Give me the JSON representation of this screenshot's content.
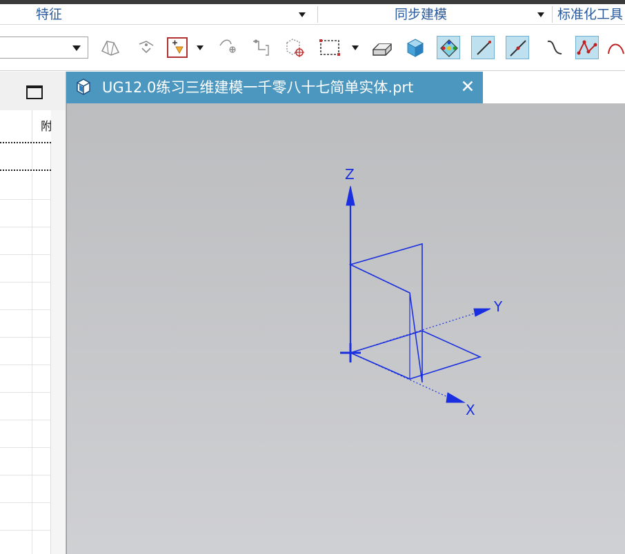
{
  "app": {
    "ribbon_groups": [
      {
        "label": "特征",
        "has_dropdown": true
      },
      {
        "label": "同步建模",
        "has_dropdown": true
      },
      {
        "label": "标准化工具",
        "has_dropdown": false
      }
    ]
  },
  "toolbar": {
    "selection_filter_value": "",
    "icons": [
      "surface-analysis-icon",
      "edge-blend-icon",
      "snap-point-icon",
      "point-constructor-icon",
      "curve-from-point-icon",
      "csys-icon",
      "box-select-icon",
      "shaded-block-icon",
      "solid-cube-icon",
      "quick-pick-icon",
      "line-icon",
      "line-point-icon",
      "curve-icon",
      "studio-spline-icon",
      "arc-icon"
    ],
    "active_icons": [
      "quick-pick-icon",
      "line-icon",
      "line-point-icon",
      "studio-spline-icon"
    ]
  },
  "navigator": {
    "column_header": "附"
  },
  "document": {
    "tab_title": "UG12.0练习三维建模一千零八十七简单实体.prt",
    "close_symbol": "✕"
  },
  "viewport": {
    "axes": {
      "z_label": "Z",
      "y_label": "Y",
      "x_label": "X"
    },
    "colors": {
      "background_top": "#bcbdbf",
      "background_bottom": "#cfd0d3",
      "geometry": "#1a2fe0",
      "tab_active": "#4c97bf",
      "ribbon_text": "#2a5a9a"
    }
  }
}
